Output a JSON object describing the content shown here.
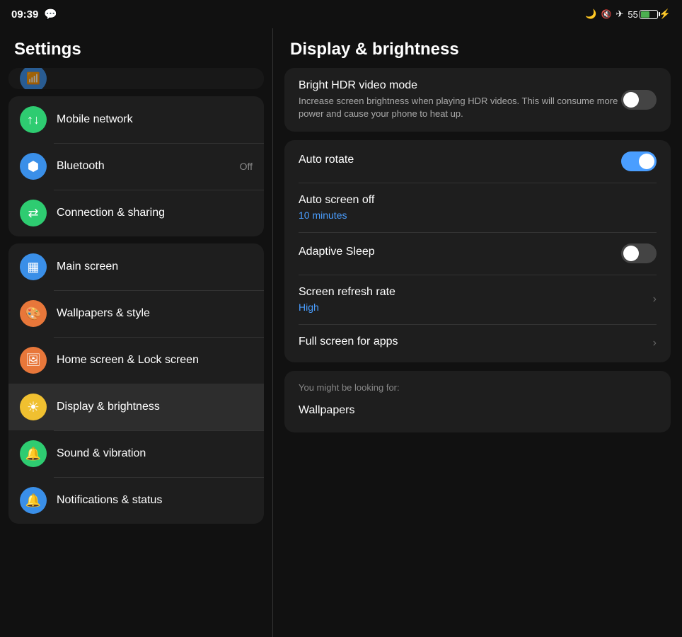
{
  "statusBar": {
    "time": "09:39",
    "whatsappIcon": "💬",
    "batteryLevel": "55",
    "icons": {
      "moon": "🌙",
      "mute": "🔇",
      "airplane": "✈",
      "bolt": "⚡"
    }
  },
  "leftPanel": {
    "title": "Settings",
    "groups": [
      {
        "id": "network-group",
        "items": [
          {
            "id": "mobile-network",
            "label": "Mobile network",
            "iconBg": "#2ecc71",
            "iconSymbol": "↑↓",
            "badge": ""
          },
          {
            "id": "bluetooth",
            "label": "Bluetooth",
            "iconBg": "#3a8fe8",
            "iconSymbol": "B",
            "badge": "Off"
          },
          {
            "id": "connection-sharing",
            "label": "Connection & sharing",
            "iconBg": "#2ecc71",
            "iconSymbol": "⇄",
            "badge": ""
          }
        ]
      },
      {
        "id": "display-group",
        "items": [
          {
            "id": "main-screen",
            "label": "Main screen",
            "iconBg": "#3a8fe8",
            "iconSymbol": "▦",
            "badge": ""
          },
          {
            "id": "wallpapers-style",
            "label": "Wallpapers & style",
            "iconBg": "#e8773a",
            "iconSymbol": "🎨",
            "badge": ""
          },
          {
            "id": "home-lock-screen",
            "label": "Home screen & Lock screen",
            "iconBg": "#e8773a",
            "iconSymbol": "🖼",
            "badge": ""
          },
          {
            "id": "display-brightness",
            "label": "Display & brightness",
            "iconBg": "#f0c030",
            "iconSymbol": "☀",
            "badge": "",
            "active": true
          },
          {
            "id": "sound-vibration",
            "label": "Sound & vibration",
            "iconBg": "#2ecc71",
            "iconSymbol": "🔔",
            "badge": ""
          },
          {
            "id": "notifications-status",
            "label": "Notifications & status",
            "iconBg": "#3a8fe8",
            "iconSymbol": "🔔",
            "badge": ""
          }
        ]
      }
    ]
  },
  "rightPanel": {
    "title": "Display & brightness",
    "cards": [
      {
        "id": "hdr-card",
        "items": [
          {
            "id": "bright-hdr",
            "title": "Bright HDR video mode",
            "subtitle": "Increase screen brightness when playing HDR videos. This will consume more power and cause your phone to heat up.",
            "toggleState": "off",
            "hasToggle": true
          }
        ]
      },
      {
        "id": "display-settings-card",
        "items": [
          {
            "id": "auto-rotate",
            "title": "Auto rotate",
            "subtitle": "",
            "toggleState": "on",
            "hasToggle": true
          },
          {
            "id": "auto-screen-off",
            "title": "Auto screen off",
            "value": "10 minutes",
            "hasToggle": false,
            "hasChevron": false
          },
          {
            "id": "adaptive-sleep",
            "title": "Adaptive Sleep",
            "subtitle": "",
            "toggleState": "off",
            "hasToggle": true
          },
          {
            "id": "screen-refresh-rate",
            "title": "Screen refresh rate",
            "value": "High",
            "hasToggle": false,
            "hasChevron": true
          },
          {
            "id": "full-screen-apps",
            "title": "Full screen for apps",
            "hasToggle": false,
            "hasChevron": true
          }
        ]
      }
    ],
    "suggestion": {
      "title": "You might be looking for:",
      "items": [
        "Wallpapers"
      ]
    }
  }
}
